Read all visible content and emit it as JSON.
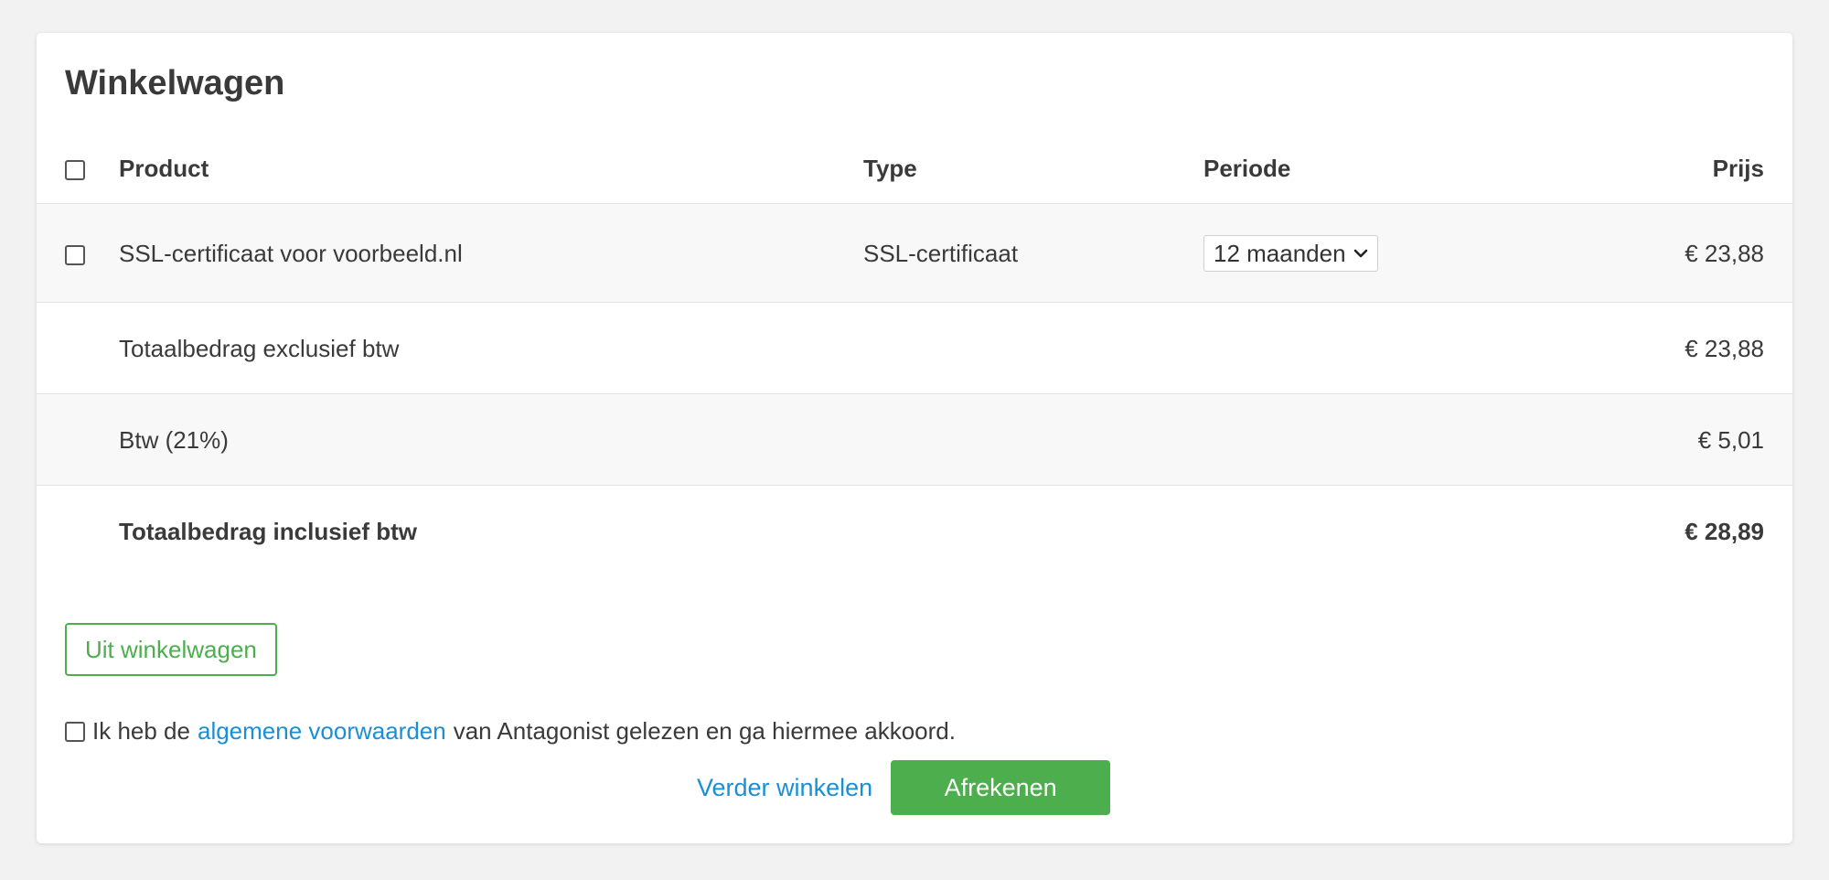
{
  "cart": {
    "title": "Winkelwagen",
    "headers": {
      "product": "Product",
      "type": "Type",
      "period": "Periode",
      "price": "Prijs"
    },
    "items": [
      {
        "product": "SSL-certificaat voor voorbeeld.nl",
        "type": "SSL-certificaat",
        "period": "12 maanden",
        "price": "€ 23,88"
      }
    ],
    "totals": {
      "excl_label": "Totaalbedrag exclusief btw",
      "excl_value": "€ 23,88",
      "vat_label": "Btw (21%)",
      "vat_value": "€ 5,01",
      "incl_label": "Totaalbedrag inclusief btw",
      "incl_value": "€ 28,89"
    },
    "remove_button": "Uit winkelwagen",
    "terms": {
      "prefix": "Ik heb de",
      "link": "algemene voorwaarden",
      "suffix": "van Antagonist gelezen en ga hiermee akkoord."
    },
    "continue_link": "Verder winkelen",
    "checkout_button": "Afrekenen"
  },
  "colors": {
    "accent_green": "#4cae4c",
    "link_blue": "#1a8fd6",
    "background": "#f2f2f2"
  }
}
